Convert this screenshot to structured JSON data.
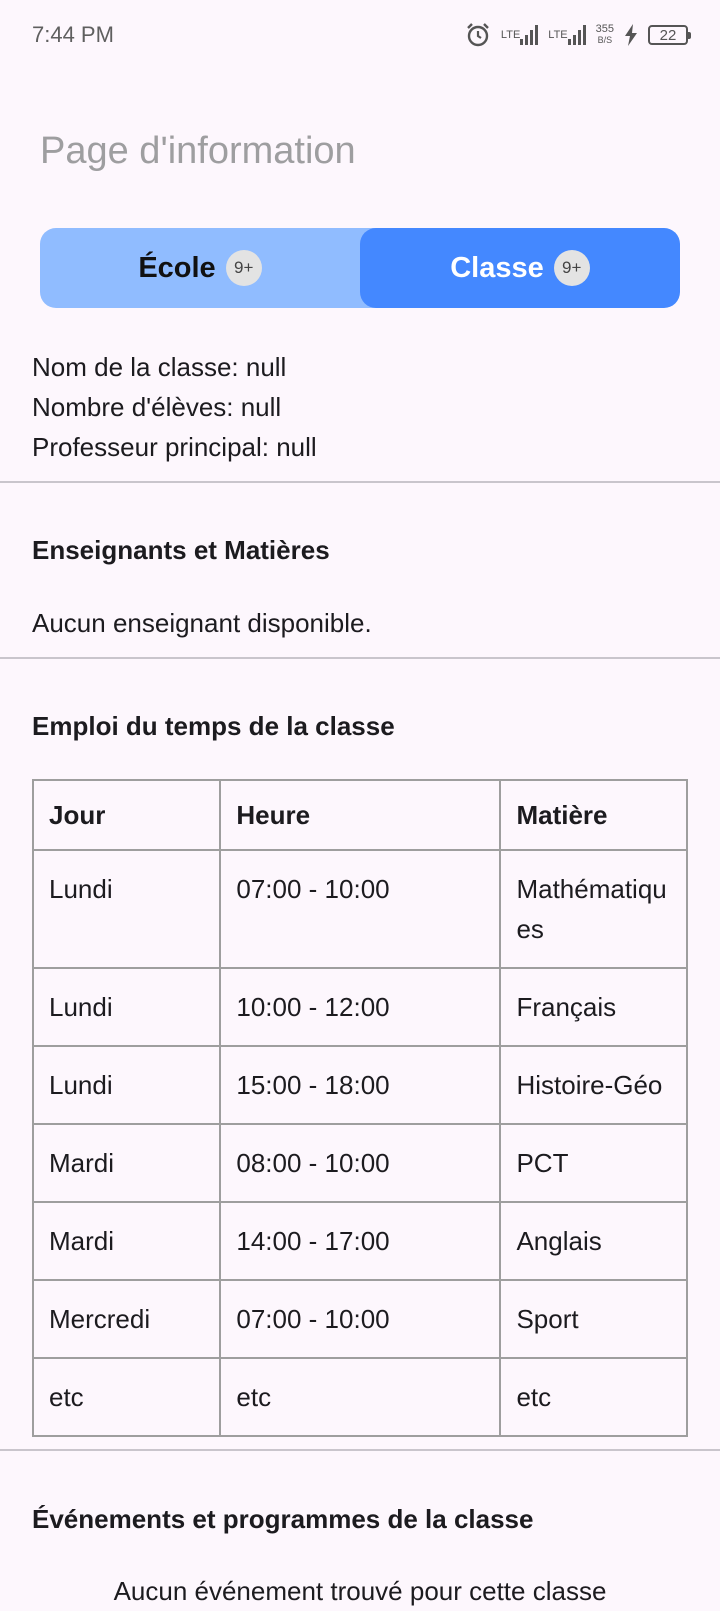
{
  "status_bar": {
    "time": "7:44 PM",
    "network_1": "LTE",
    "network_2": "LTE",
    "speed_value": "355",
    "speed_unit": "B/S",
    "battery": "22"
  },
  "header": {
    "title": "Page d'information"
  },
  "tabs": [
    {
      "label": "École",
      "badge": "9+",
      "active": false
    },
    {
      "label": "Classe",
      "badge": "9+",
      "active": true
    }
  ],
  "class_info": {
    "name_line": "Nom de la classe: null",
    "students_line": "Nombre d'élèves: null",
    "teacher_line": "Professeur principal: null"
  },
  "teachers_section": {
    "title": "Enseignants et Matières",
    "empty_text": "Aucun enseignant disponible."
  },
  "timetable_section": {
    "title": "Emploi du temps de la classe",
    "headers": [
      "Jour",
      "Heure",
      "Matière"
    ],
    "rows": [
      [
        "Lundi",
        "07:00 - 10:00",
        "Mathématiques"
      ],
      [
        "Lundi",
        "10:00 - 12:00",
        "Français"
      ],
      [
        "Lundi",
        "15:00 - 18:00",
        "Histoire-Géo"
      ],
      [
        "Mardi",
        "08:00 - 10:00",
        "PCT"
      ],
      [
        "Mardi",
        "14:00 - 17:00",
        "Anglais"
      ],
      [
        "Mercredi",
        "07:00 - 10:00",
        "Sport"
      ],
      [
        "etc",
        "etc",
        "etc"
      ]
    ]
  },
  "events_section": {
    "title": "Événements et programmes de la classe",
    "empty_text": "Aucun événement trouvé pour cette classe"
  }
}
